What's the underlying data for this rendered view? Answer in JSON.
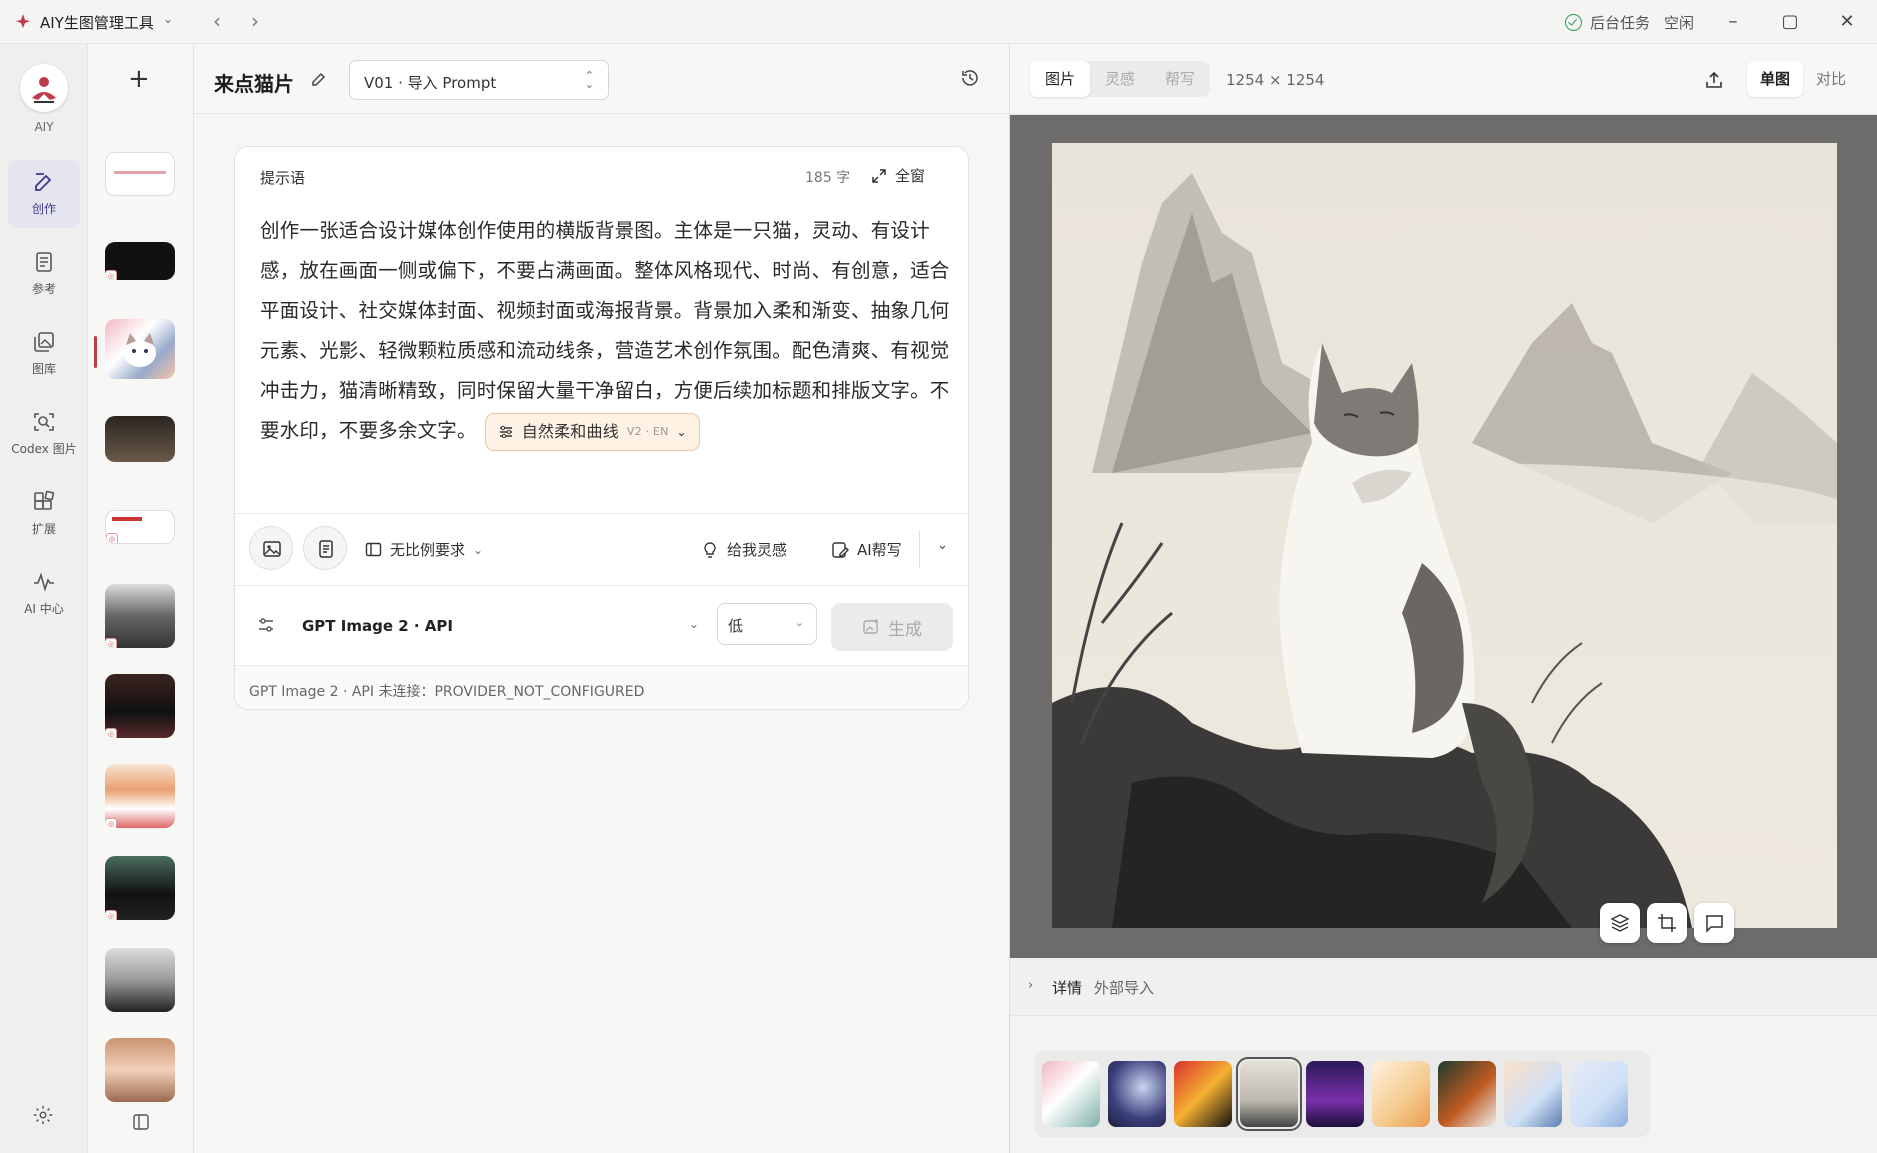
{
  "app": {
    "title": "AIY生图管理工具",
    "status_label": "后台任务",
    "status_value": "空闲"
  },
  "rail": {
    "logo_label": "AIY",
    "items": [
      {
        "label": "创作",
        "icon": "edit-icon"
      },
      {
        "label": "参考",
        "icon": "document-icon"
      },
      {
        "label": "图库",
        "icon": "gallery-icon"
      },
      {
        "label": "Codex 图片",
        "icon": "scan-image-icon"
      },
      {
        "label": "扩展",
        "icon": "extension-icon"
      },
      {
        "label": "AI 中心",
        "icon": "pulse-icon"
      }
    ]
  },
  "editor": {
    "title": "来点猫片",
    "version": "V01 · 导入 Prompt",
    "prompt_label": "提示语",
    "char_count": "185 字",
    "fullscreen_label": "全窗",
    "prompt_text": "创作一张适合设计媒体创作使用的横版背景图。主体是一只猫，灵动、有设计感，放在画面一侧或偏下，不要占满画面。整体风格现代、时尚、有创意，适合平面设计、社交媒体封面、视频封面或海报背景。背景加入柔和渐变、抽象几何元素、光影、轻微颗粒质感和流动线条，营造艺术创作氛围。配色清爽、有视觉冲击力，猫清晰精致，同时保留大量干净留白，方便后续加标题和排版文字。不要水印，不要多余文字。",
    "style_chip": "自然柔和曲线",
    "style_chip_version": "V2 · EN",
    "ratio_label": "无比例要求",
    "inspire_label": "给我灵感",
    "ai_write_label": "AI帮写",
    "model_name": "GPT Image 2 · API",
    "quality": "低",
    "generate_label": "生成",
    "error_text": "GPT Image 2 · API 未连接：PROVIDER_NOT_CONFIGURED"
  },
  "viewer": {
    "tabs": [
      "图片",
      "灵感",
      "帮写"
    ],
    "image_size": "1254 × 1254",
    "mode_single": "单图",
    "mode_compare": "对比",
    "details_label": "详情",
    "details_value": "外部导入"
  },
  "colors": {
    "accent": "#3c3c8c",
    "selection": "#c0394b",
    "status_ok": "#2f9a52",
    "chip_bg": "#fdf2e4"
  }
}
